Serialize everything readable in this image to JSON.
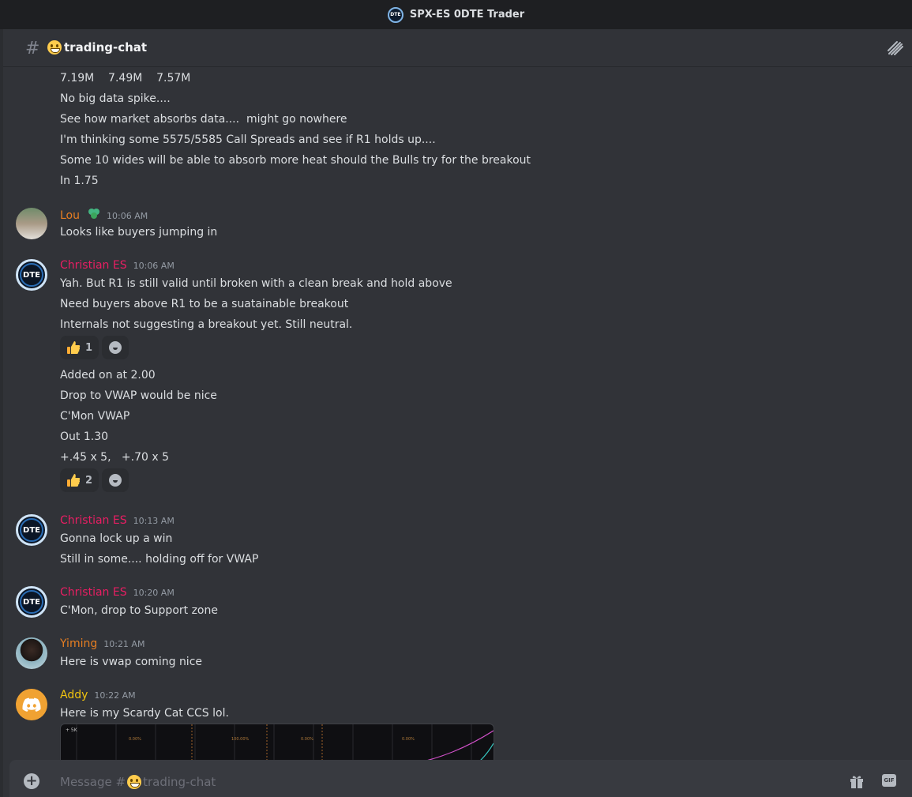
{
  "window": {
    "title": "SPX-ES 0DTE Trader"
  },
  "channel": {
    "name": "trading-chat",
    "hash": "#"
  },
  "messages": {
    "continued": [
      "7.19M    7.49M    7.57M",
      "No big data spike....",
      "See how market absorbs data....  might go nowhere",
      "I'm thinking some 5575/5585 Call Spreads and see if R1 holds up....",
      "Some 10 wides will be able to absorb more heat should the Bulls try for the breakout",
      "In 1.75"
    ],
    "m1": {
      "author": "Lou",
      "time": "10:06 AM",
      "lines": [
        "Looks like buyers jumping in"
      ]
    },
    "m2": {
      "author": "Christian ES",
      "time": "10:06 AM",
      "lines": [
        "Yah. But R1 is still valid until broken with a clean break and hold above",
        "Need buyers above R1 to be a suatainable breakout",
        "Internals not suggesting a breakout yet. Still neutral."
      ],
      "reaction_count": "1",
      "lines_after": [
        "Added on at 2.00",
        "Drop to VWAP would be nice",
        "C'Mon VWAP",
        "Out 1.30",
        "+.45 x 5,   +.70 x 5"
      ],
      "reaction_count_2": "2"
    },
    "m3": {
      "author": "Christian ES",
      "time": "10:13 AM",
      "lines": [
        "Gonna lock up a win",
        "Still in some.... holding off for VWAP"
      ]
    },
    "m4": {
      "author": "Christian ES",
      "time": "10:20 AM",
      "lines": [
        "C'Mon, drop to Support zone"
      ]
    },
    "m5": {
      "author": "Yiming",
      "time": "10:21 AM",
      "lines": [
        "Here is vwap coming nice"
      ]
    },
    "m6": {
      "author": "Addy",
      "time": "10:22 AM",
      "lines": [
        "Here is my Scardy Cat CCS lol."
      ]
    }
  },
  "avatar_text": {
    "dte": "DTE"
  },
  "chart_labels": {
    "corner": "+ 5K",
    "l1": "0.00%",
    "l2": "100.00%",
    "l3": "0.00%",
    "l4": "0.00%"
  },
  "composer": {
    "prefix": "Message #",
    "channel": "trading-chat",
    "gif": "GIF"
  }
}
